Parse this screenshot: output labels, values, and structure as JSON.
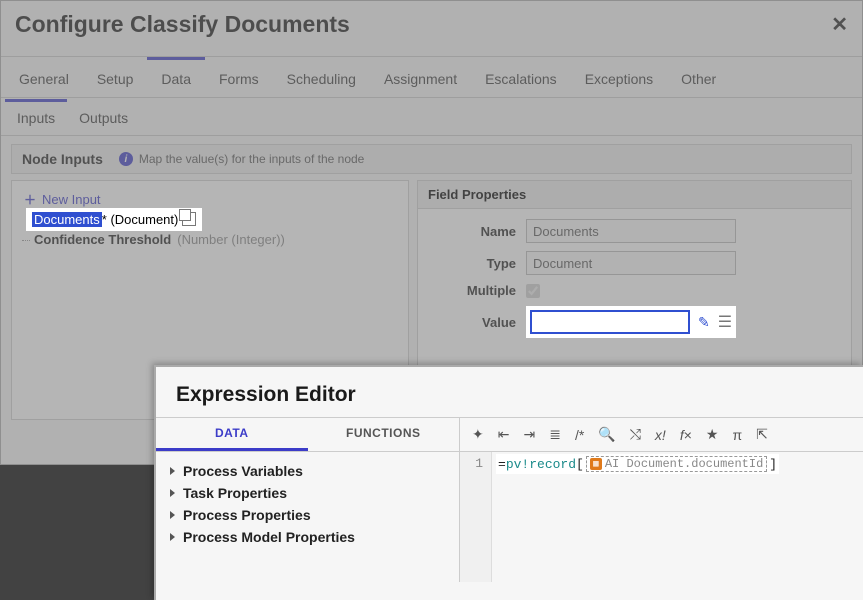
{
  "dialog": {
    "title": "Configure Classify Documents"
  },
  "tabs": [
    "General",
    "Setup",
    "Data",
    "Forms",
    "Scheduling",
    "Assignment",
    "Escalations",
    "Exceptions",
    "Other"
  ],
  "active_tab": "Data",
  "subtabs": [
    "Inputs",
    "Outputs"
  ],
  "active_subtab": "Inputs",
  "section": {
    "title": "Node Inputs",
    "hint": "Map the value(s) for the inputs of the node"
  },
  "left_panel": {
    "new_input_label": "New Input",
    "items": [
      {
        "name": "Documents",
        "required": true,
        "type": "(Document)",
        "selected": true
      },
      {
        "name": "Confidence Threshold",
        "required": false,
        "type": "(Number (Integer))",
        "selected": false
      }
    ]
  },
  "field_properties": {
    "header": "Field Properties",
    "name_label": "Name",
    "name_value": "Documents",
    "type_label": "Type",
    "type_value": "Document",
    "multiple_label": "Multiple",
    "multiple_checked": true,
    "value_label": "Value",
    "value_value": ""
  },
  "expression_editor": {
    "title": "Expression Editor",
    "tabs": [
      "DATA",
      "FUNCTIONS"
    ],
    "active_tab": "DATA",
    "tree": [
      "Process Variables",
      "Task Properties",
      "Process Properties",
      "Process Model Properties"
    ],
    "toolbar_icons": [
      "magic-wand-icon",
      "outdent-icon",
      "indent-icon",
      "list-icon",
      "comment-icon",
      "search-icon",
      "shuffle-icon",
      "x-italic-icon",
      "fx-icon",
      "star-icon",
      "pi-icon",
      "export-icon"
    ],
    "code": {
      "line_number": "1",
      "prefix": "=",
      "pv": "pv!record",
      "open": "[",
      "record_label": "AI Document.documentId",
      "close": "]"
    }
  }
}
